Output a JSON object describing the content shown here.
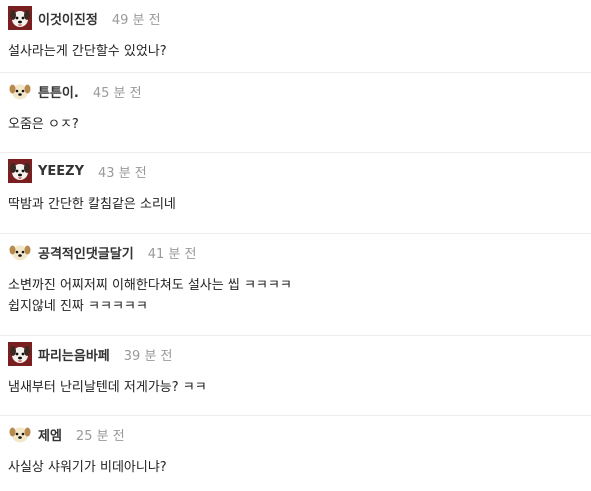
{
  "comments": [
    {
      "avatar": "dog-avatar-red",
      "nick": "이것이진정",
      "time": "49 분 전",
      "lines": [
        "설사라는게 간단할수 있었나?"
      ]
    },
    {
      "avatar": "dog-avatar-cream",
      "nick": "튼튼이.",
      "time": "45 분 전",
      "lines": [
        "오줌은 ㅇㅈ?"
      ]
    },
    {
      "avatar": "dog-avatar-red",
      "nick": "YEEZY",
      "time": "43 분 전",
      "lines": [
        "딱밤과 간단한 칼침같은 소리네"
      ]
    },
    {
      "avatar": "dog-avatar-cream",
      "nick": "공격적인댓글달기",
      "time": "41 분 전",
      "lines": [
        "소변까진 어찌저찌 이해한다쳐도 설사는 씹 ㅋㅋㅋㅋ",
        "쉽지않네 진짜 ㅋㅋㅋㅋㅋ"
      ]
    },
    {
      "avatar": "dog-avatar-red",
      "nick": "파리는음바페",
      "time": "39 분 전",
      "lines": [
        "냄새부터 난리날텐데 저게가능? ㅋㅋ"
      ]
    },
    {
      "avatar": "dog-avatar-cream",
      "nick": "제엠",
      "time": "25 분 전",
      "lines": [
        "사실상 샤워기가 비데아니냐?"
      ]
    }
  ]
}
